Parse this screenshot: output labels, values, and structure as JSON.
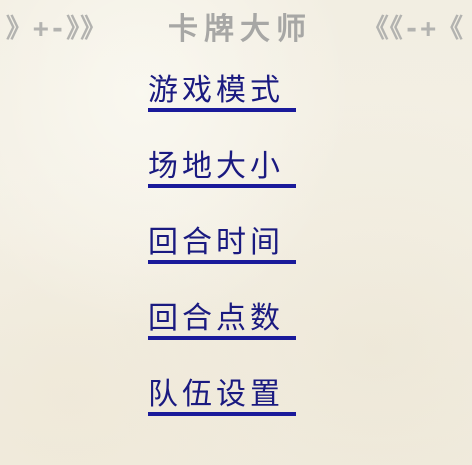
{
  "title": {
    "left_decoration": "》+-》》",
    "text": "卡牌大师",
    "right_decoration": "《《-+《"
  },
  "menu": {
    "items": [
      {
        "label": "游戏模式"
      },
      {
        "label": "场地大小"
      },
      {
        "label": "回合时间"
      },
      {
        "label": "回合点数"
      },
      {
        "label": "队伍设置"
      }
    ]
  }
}
